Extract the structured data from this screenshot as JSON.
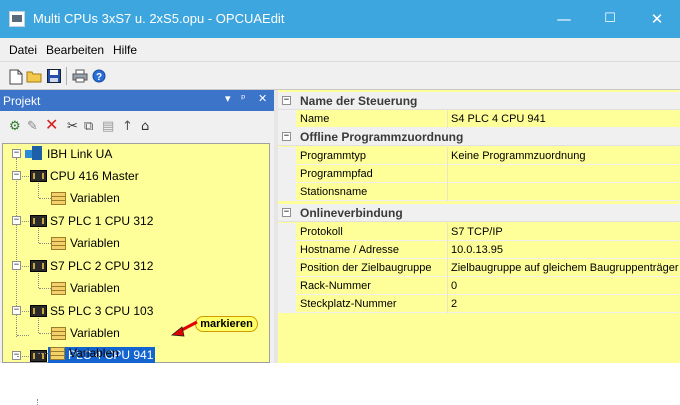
{
  "window": {
    "title": "Multi CPUs 3xS7 u. 2xS5.opu - OPCUAEdit",
    "controls": [
      "—",
      "☐",
      "✕"
    ]
  },
  "menu": [
    "Datei",
    "Bearbeiten",
    "Hilfe"
  ],
  "toolbar": [
    "new-file-icon",
    "open-folder-icon",
    "save-icon",
    "print-icon",
    "help-icon"
  ],
  "project_panel": {
    "title": "Projekt",
    "header_buttons": [
      "▾",
      "ᵖ",
      "✕"
    ],
    "tools": [
      "connect-icon",
      "edit-icon",
      "delete-icon",
      "cut-icon",
      "copy-icon",
      "paste-icon",
      "move-up-icon",
      "home-icon"
    ]
  },
  "tree": {
    "root": "IBH Link UA",
    "nodes": [
      {
        "label": "CPU 416 Master",
        "child": "Variablen"
      },
      {
        "label": "S7 PLC 1 CPU 312",
        "child": "Variablen"
      },
      {
        "label": "S7 PLC 2 CPU 312",
        "child": "Variablen"
      },
      {
        "label": "S5 PLC 3 CPU 103",
        "child": "Variablen"
      },
      {
        "label": "S4 PLC 4 CPU 941",
        "child": "Variablen",
        "selected": true
      }
    ],
    "callout": "markieren"
  },
  "properties": [
    {
      "category": "Name der Steuerung",
      "items": [
        {
          "name": "Name",
          "value": "S4 PLC 4 CPU 941"
        }
      ]
    },
    {
      "category": "Offline Programmzuordnung",
      "items": [
        {
          "name": "Programmtyp",
          "value": "Keine Programmzuordnung"
        },
        {
          "name": "Programmpfad",
          "value": ""
        },
        {
          "name": "Stationsname",
          "value": ""
        }
      ]
    },
    {
      "category": "Onlineverbindung",
      "items": [
        {
          "name": "Protokoll",
          "value": "S7 TCP/IP"
        },
        {
          "name": "Hostname / Adresse",
          "value": "10.0.13.95"
        },
        {
          "name": "Position der Zielbaugruppe",
          "value": "Zielbaugruppe auf gleichem Baugruppenträger"
        },
        {
          "name": "Rack-Nummer",
          "value": "0"
        },
        {
          "name": "Steckplatz-Nummer",
          "value": "2"
        }
      ]
    }
  ],
  "colors": {
    "titlebar": "#3ea6de",
    "panel_header": "#3c74c9",
    "tree_background": "#ffff99",
    "selection": "#1464d0",
    "callout_arrow": "#e00000"
  }
}
